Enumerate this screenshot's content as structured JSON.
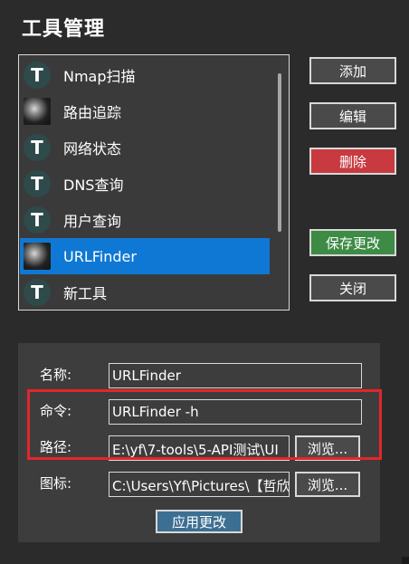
{
  "window": {
    "title": "工具管理"
  },
  "tool_list": {
    "items": [
      {
        "label": "Nmap扫描",
        "icon": "letter-t-icon",
        "selected": false
      },
      {
        "label": "路由追踪",
        "icon": "image-icon",
        "selected": false
      },
      {
        "label": "网络状态",
        "icon": "letter-t-icon",
        "selected": false
      },
      {
        "label": "DNS查询",
        "icon": "letter-t-icon",
        "selected": false
      },
      {
        "label": "用户查询",
        "icon": "letter-t-icon",
        "selected": false
      },
      {
        "label": "URLFinder",
        "icon": "image-icon",
        "selected": true
      },
      {
        "label": "新工具",
        "icon": "letter-t-icon",
        "selected": false
      }
    ],
    "icon_letter": "T"
  },
  "actions": {
    "add": "添加",
    "edit": "编辑",
    "delete": "删除",
    "save": "保存更改",
    "close": "关闭"
  },
  "form": {
    "name_label": "名称:",
    "name_value": "URLFinder",
    "command_label": "命令:",
    "command_value": "URLFinder -h",
    "path_label": "路径:",
    "path_value": "E:\\yf\\7-tools\\5-API测试\\UI",
    "icon_label": "图标:",
    "icon_value": "C:\\Users\\Yf\\Pictures\\【哲欣",
    "browse": "浏览...",
    "apply": "应用更改"
  },
  "colors": {
    "background": "#2b2b2b",
    "selected": "#0f78d4",
    "delete": "#c83a3f",
    "save": "#3d8b45",
    "apply": "#3c6f91",
    "highlight": "#e3262c"
  }
}
